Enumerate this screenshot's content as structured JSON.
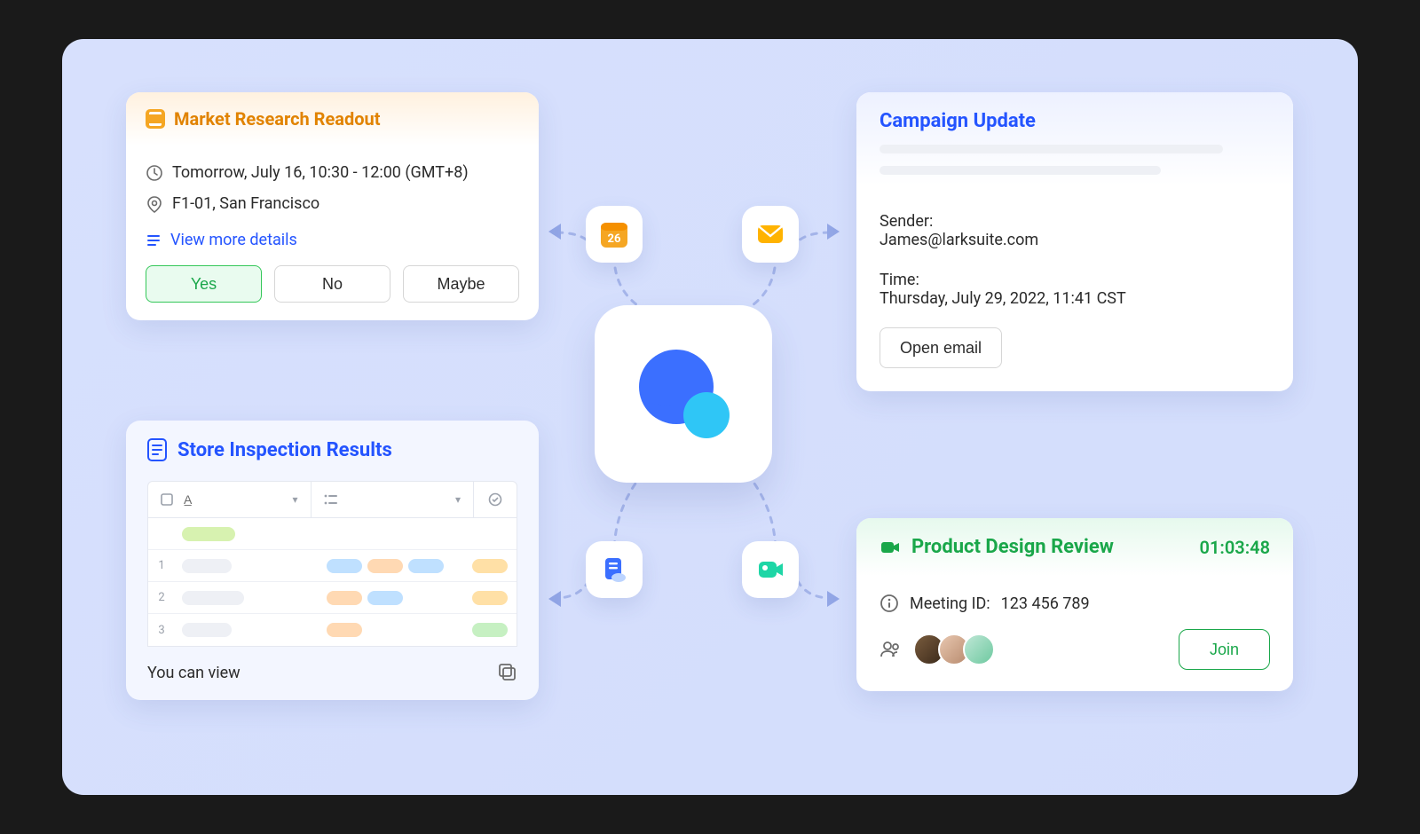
{
  "market": {
    "title": "Market Research Readout",
    "datetime": "Tomorrow, July 16, 10:30 - 12:00 (GMT+8)",
    "location": "F1-01, San Francisco",
    "more_link": "View more details",
    "rsvp": {
      "yes": "Yes",
      "no": "No",
      "maybe": "Maybe"
    }
  },
  "email": {
    "title": "Campaign Update",
    "sender_label": "Sender:",
    "sender_value": "James@larksuite.com",
    "time_label": "Time:",
    "time_value": "Thursday, July 29, 2022, 11:41 CST",
    "open_label": "Open email"
  },
  "store": {
    "title": "Store Inspection Results",
    "footer_text": "You can view"
  },
  "meeting": {
    "title": "Product Design Review",
    "elapsed": "01:03:48",
    "id_label": "Meeting ID:",
    "id_value": "123 456 789",
    "join_label": "Join"
  },
  "hub_calendar_day": "26"
}
